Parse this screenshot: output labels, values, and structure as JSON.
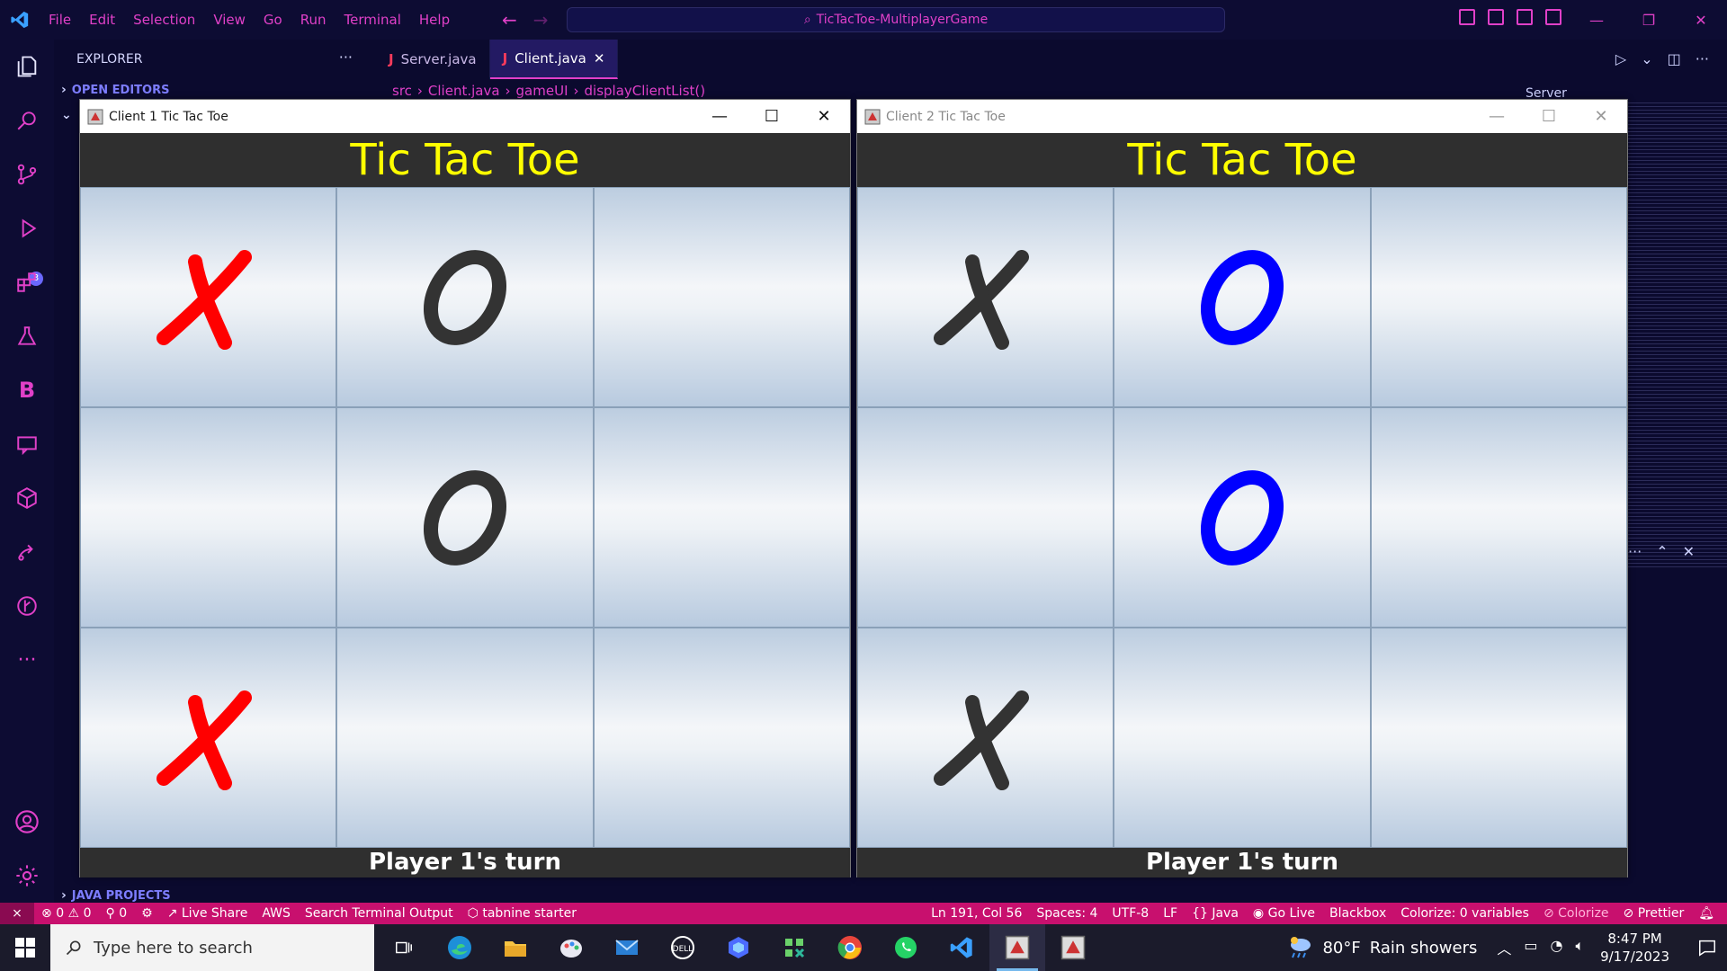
{
  "titlebar": {
    "menu": [
      "File",
      "Edit",
      "Selection",
      "View",
      "Go",
      "Run",
      "Terminal",
      "Help"
    ],
    "search_text": "TicTacToe-MultiplayerGame"
  },
  "sidebar": {
    "header": "EXPLORER",
    "open_editors": "OPEN EDITORS",
    "java_projects": "JAVA PROJECTS"
  },
  "activity_badge": "3",
  "editor": {
    "tabs": [
      {
        "label": "Server.java",
        "active": false
      },
      {
        "label": "Client.java",
        "active": true
      }
    ],
    "breadcrumb": [
      "src",
      "Client.java",
      "gameUI",
      "displayClientList()"
    ],
    "server_label": "Server"
  },
  "windows": [
    {
      "title": "Client 1 Tic Tac Toe",
      "game_title": "Tic Tac Toe",
      "board": [
        [
          "X",
          "O",
          ""
        ],
        [
          "",
          "O",
          ""
        ],
        [
          "X",
          "",
          ""
        ]
      ],
      "x_color": "#ff0000",
      "o_color": "#333333",
      "turn_text": "Player 1's turn"
    },
    {
      "title": "Client 2 Tic Tac Toe",
      "game_title": "Tic Tac Toe",
      "board": [
        [
          "X",
          "O",
          ""
        ],
        [
          "",
          "O",
          ""
        ],
        [
          "X",
          "",
          ""
        ]
      ],
      "x_color": "#333333",
      "o_color": "#0000ff",
      "turn_text": "Player 1's turn"
    }
  ],
  "statusbar": {
    "errors": "0",
    "warnings": "0",
    "ports": "0",
    "live_share": "Live Share",
    "aws": "AWS",
    "search_terminal": "Search Terminal Output",
    "tabnine": "tabnine starter",
    "position": "Ln 191, Col 56",
    "spaces": "Spaces: 4",
    "encoding": "UTF-8",
    "eol": "LF",
    "language": "Java",
    "go_live": "Go Live",
    "blackbox": "Blackbox",
    "colorize_vars": "Colorize: 0 variables",
    "colorize": "Colorize",
    "prettier": "Prettier"
  },
  "taskbar": {
    "search_placeholder": "Type here to search",
    "weather_temp": "80°F",
    "weather_desc": "Rain showers",
    "time": "8:47 PM",
    "date": "9/17/2023"
  },
  "colors": {
    "accent": "#e040c8",
    "statusbar": "#c8106e",
    "background": "#0b0a2e",
    "game_title": "#ffff00"
  }
}
